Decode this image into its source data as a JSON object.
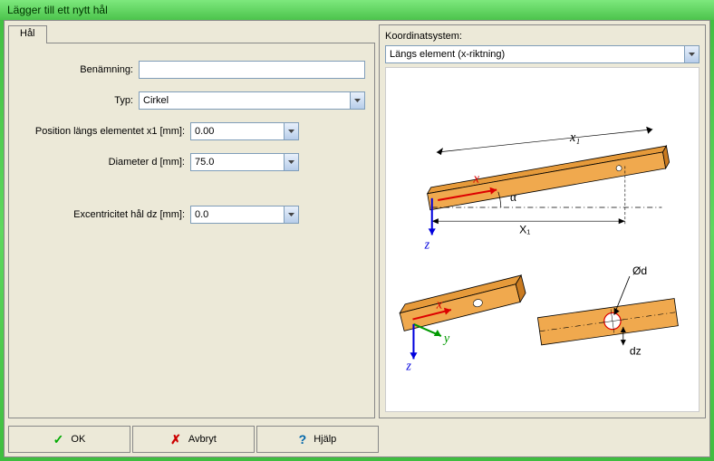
{
  "window": {
    "title": "Lägger till ett nytt hål"
  },
  "tabs": {
    "hal": "Hål"
  },
  "form": {
    "benamning_label": "Benämning:",
    "benamning_value": "",
    "typ_label": "Typ:",
    "typ_value": "Cirkel",
    "pos_label": "Position längs elementet x1 [mm]:",
    "pos_value": "0.00",
    "dia_label": "Diameter d [mm]:",
    "dia_value": "75.0",
    "exc_label": "Excentricitet hål dz [mm]:",
    "exc_value": "0.0"
  },
  "coord": {
    "label": "Koordinatsystem:",
    "value": "Längs element (x-riktning)"
  },
  "diagram": {
    "x_italic": "x",
    "x1_italic": "x₁",
    "X1": "X₁",
    "alpha": "α",
    "z": "z",
    "y": "y",
    "Od": "Ød",
    "dz": "dz"
  },
  "buttons": {
    "ok": "OK",
    "cancel": "Avbryt",
    "help": "Hjälp"
  }
}
